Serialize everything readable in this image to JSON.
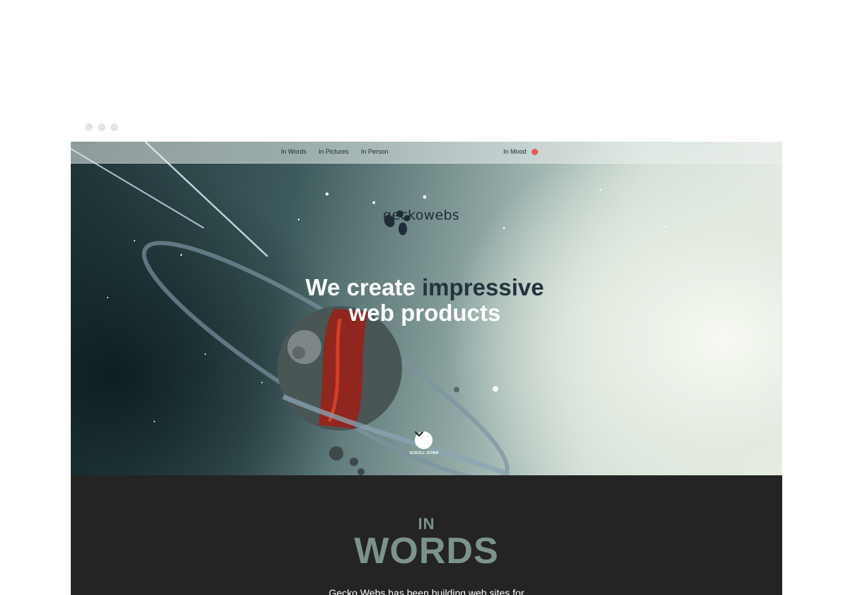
{
  "nav": {
    "links": [
      "In Words",
      "In Pictures",
      "In Person",
      "In Mood"
    ],
    "indicator": {
      "count": 4,
      "active_index": 0
    }
  },
  "logo": {
    "text": "geckowebs"
  },
  "hero": {
    "headline_white_1": "We create ",
    "headline_dark_1": "impressive",
    "headline_white_2": "web products",
    "scroll_label": "SCROLL DOWN"
  },
  "section": {
    "kicker": "IN",
    "title": "WORDS",
    "intro": "Gecko Webs has been building web sites for"
  },
  "colors": {
    "accent": "#e35b4f",
    "section_bg": "#232423",
    "section_title": "#7c928d",
    "nav_text": "#1d2a30"
  }
}
